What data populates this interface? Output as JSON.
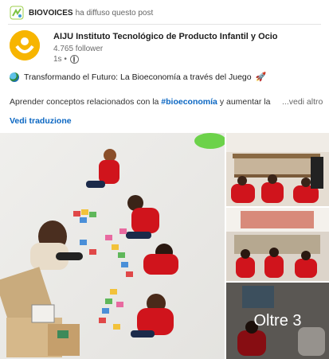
{
  "repost": {
    "name": "BIOVOICES",
    "action": "ha diffuso questo post"
  },
  "author": {
    "name": "AIJU Instituto Tecnológico de Producto Infantil y Ocio",
    "followers": "4.765 follower",
    "time": "1s •"
  },
  "post": {
    "headline": "Transformando el Futuro: La Bioeconomía a través del Juego",
    "body_prefix": "Aprender conceptos relacionados con la ",
    "hashtag": "#bioeconomía",
    "body_suffix": " y aumentar la",
    "more": "...vedi altro",
    "translate": "Vedi traduzione"
  },
  "gallery": {
    "overlay_text": "Oltre 3"
  },
  "colors": {
    "link": "#0a66c2",
    "logo": "#f7b500",
    "shirt": "#d0141c"
  },
  "icons": [
    "biovoices-logo-icon",
    "globe-icon",
    "earth-emoji-icon",
    "rocket-emoji-icon"
  ]
}
